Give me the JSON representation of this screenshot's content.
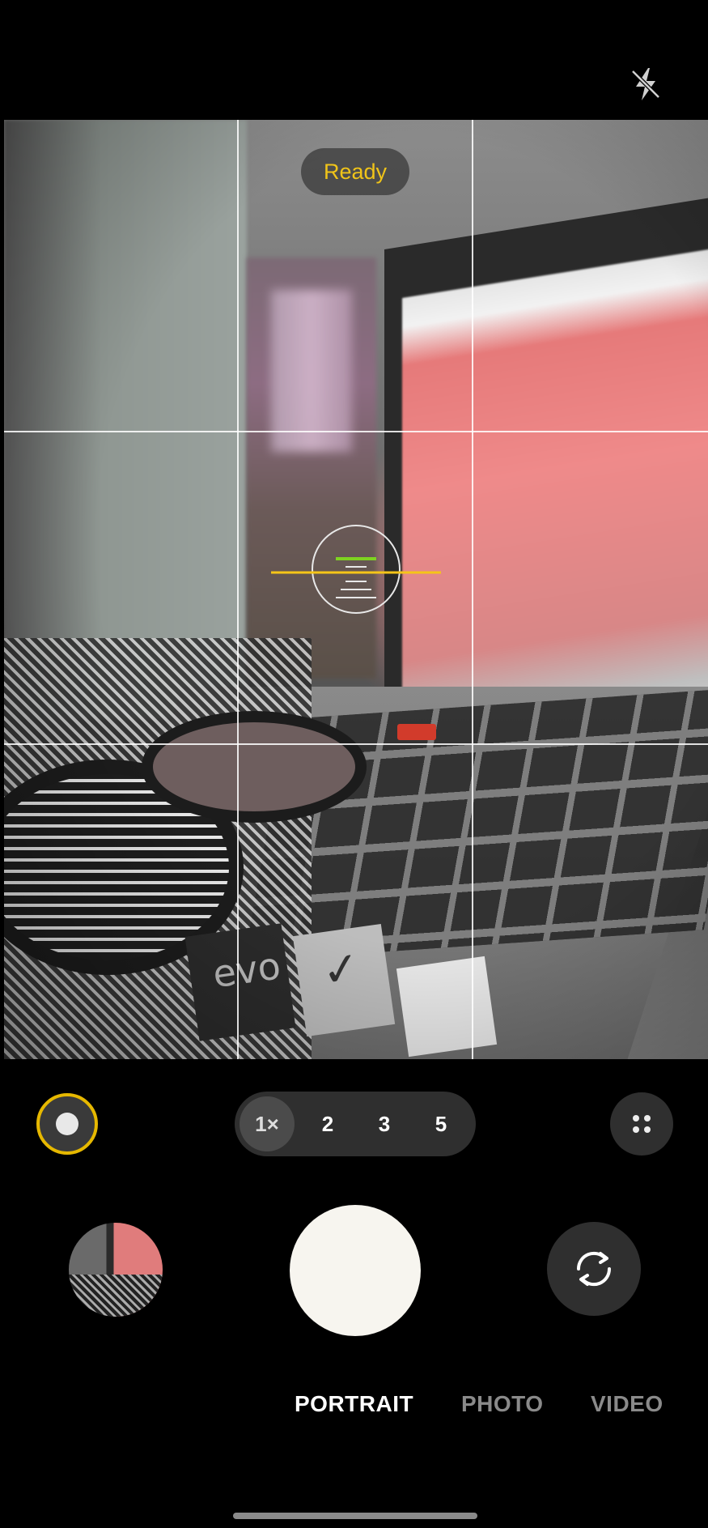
{
  "status": {
    "label": "Ready"
  },
  "top_bar": {
    "flash_icon": "flash-off-icon"
  },
  "zoom": {
    "options": [
      {
        "label": "1×",
        "active": true
      },
      {
        "label": "2",
        "active": false
      },
      {
        "label": "3",
        "active": false
      },
      {
        "label": "5",
        "active": false
      }
    ]
  },
  "modes": [
    {
      "label": "PORTRAIT",
      "active": true
    },
    {
      "label": "PHOTO",
      "active": false
    },
    {
      "label": "VIDEO",
      "active": false
    }
  ],
  "colors": {
    "accent": "#f0c419",
    "level_green": "#7ed321",
    "level_yellow": "#f5c518"
  },
  "icons": {
    "portrait_toggle": "portrait-effect-icon",
    "more": "more-options-icon",
    "switch_camera": "switch-camera-icon"
  }
}
